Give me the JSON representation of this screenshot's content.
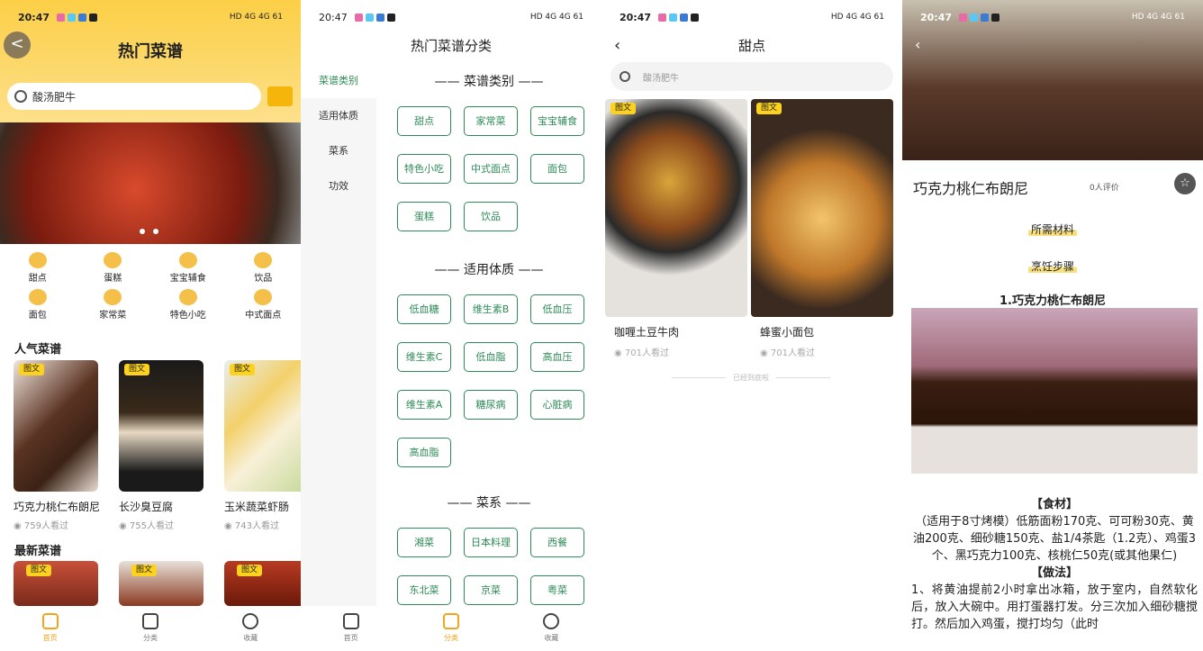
{
  "status": {
    "time": "20:47",
    "icons": "HD 4G 4G 61"
  },
  "home": {
    "title": "热门菜谱",
    "back_label": "<",
    "search_placeholder": "酸汤肥牛",
    "categories": [
      "甜点",
      "蛋糕",
      "宝宝辅食",
      "饮品",
      "面包",
      "家常菜",
      "特色小吃",
      "中式面点"
    ],
    "popular_title": "人气菜谱",
    "popular": [
      {
        "name": "巧克力桃仁布朗尼",
        "views": "759人看过",
        "tag": "图文"
      },
      {
        "name": "长沙臭豆腐",
        "views": "755人看过",
        "tag": "图文"
      },
      {
        "name": "玉米蔬菜虾肠",
        "views": "743人看过",
        "tag": "图文"
      }
    ],
    "latest_title": "最新菜谱",
    "latest_tags": [
      "图文",
      "图文",
      "图文"
    ],
    "tabs": [
      "首页",
      "分类",
      "收藏"
    ]
  },
  "category": {
    "title": "热门菜谱分类",
    "side": [
      "菜谱类别",
      "适用体质",
      "菜系",
      "功效"
    ],
    "groups": [
      {
        "title": "—— 菜谱类别 ——",
        "items": [
          "甜点",
          "家常菜",
          "宝宝辅食",
          "特色小吃",
          "中式面点",
          "面包",
          "蛋糕",
          "饮品"
        ]
      },
      {
        "title": "—— 适用体质 ——",
        "items": [
          "低血糖",
          "维生素B",
          "低血压",
          "维生素C",
          "低血脂",
          "高血压",
          "维生素A",
          "糖尿病",
          "心脏病",
          "高血脂"
        ]
      },
      {
        "title": "—— 菜系 ——",
        "items": [
          "湘菜",
          "日本料理",
          "西餐",
          "东北菜",
          "京菜",
          "粤菜"
        ]
      }
    ],
    "tabs": [
      "首页",
      "分类",
      "收藏"
    ]
  },
  "list": {
    "title": "甜点",
    "search_placeholder": "酸汤肥牛",
    "items": [
      {
        "name": "咖喱土豆牛肉",
        "views": "701人看过",
        "tag": "图文"
      },
      {
        "name": "蜂蜜小面包",
        "views": "701人看过",
        "tag": "图文"
      }
    ],
    "end_text": "已经到底啦"
  },
  "detail": {
    "name": "巧克力桃仁布朗尼",
    "reviews": "0人评价",
    "materials_label": "所需材料",
    "steps_label": "烹饪步骤",
    "step_title": "1.巧克力桃仁布朗尼",
    "ingredients_head": "【食材】",
    "ingredients": "（适用于8寸烤模）低筋面粉170克、可可粉30克、黄油200克、细砂糖150克、盐1/4茶匙（1.2克）、鸡蛋3个、黑巧克力100克、核桃仁50克(或其他果仁)",
    "method_head": "【做法】",
    "method": "1、将黄油提前2小时拿出冰箱，放于室内，自然软化后，放入大碗中。用打蛋器打发。分三次加入细砂糖搅打。然后加入鸡蛋，搅打均匀（此时"
  }
}
